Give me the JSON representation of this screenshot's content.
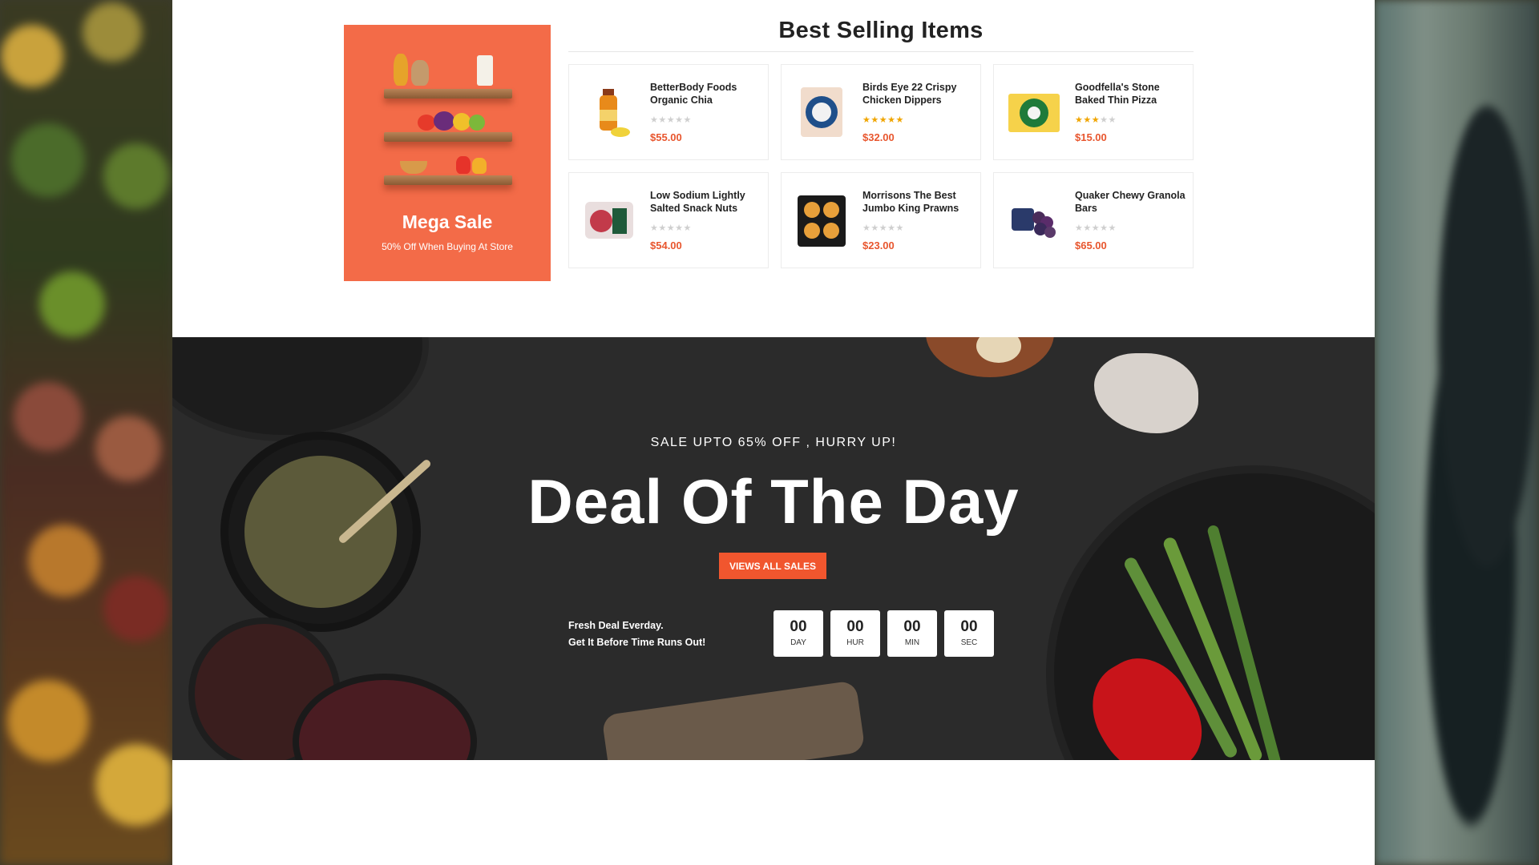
{
  "best_selling": {
    "title": "Best Selling Items",
    "promo": {
      "title": "Mega Sale",
      "subtitle": "50% Off When Buying At Store"
    },
    "products": [
      {
        "name": "BetterBody Foods Organic Chia",
        "price": "$55.00",
        "rating": 0,
        "icon": "juice-bottle-icon"
      },
      {
        "name": "Birds Eye 22 Crispy Chicken Dippers",
        "price": "$32.00",
        "rating": 5,
        "icon": "king-prawns-pack-icon"
      },
      {
        "name": "Goodfella's Stone Baked Thin Pizza",
        "price": "$15.00",
        "rating": 3,
        "icon": "pizza-box-icon"
      },
      {
        "name": "Low Sodium Lightly Salted Snack Nuts",
        "price": "$54.00",
        "rating": 0,
        "icon": "raspberry-pack-icon"
      },
      {
        "name": "Morrisons The Best Jumbo King Prawns",
        "price": "$23.00",
        "rating": 0,
        "icon": "pies-tray-icon"
      },
      {
        "name": "Quaker Chewy Granola Bars",
        "price": "$65.00",
        "rating": 0,
        "icon": "grapes-icon"
      }
    ]
  },
  "deal": {
    "eyebrow": "SALE UPTO 65% OFF , HURRY UP!",
    "title": "Deal Of The Day",
    "button_label": "VIEWS ALL SALES",
    "note_line1": "Fresh Deal Everday.",
    "note_line2": "Get It Before Time Runs Out!",
    "countdown": [
      {
        "value": "00",
        "label": "DAY"
      },
      {
        "value": "00",
        "label": "HUR"
      },
      {
        "value": "00",
        "label": "MIN"
      },
      {
        "value": "00",
        "label": "SEC"
      }
    ]
  },
  "colors": {
    "accent": "#f1562e",
    "promo_bg": "#f36b48",
    "star_filled": "#f0a500",
    "star_empty": "#cfcfcf",
    "deal_bg": "#2b2b2b"
  }
}
